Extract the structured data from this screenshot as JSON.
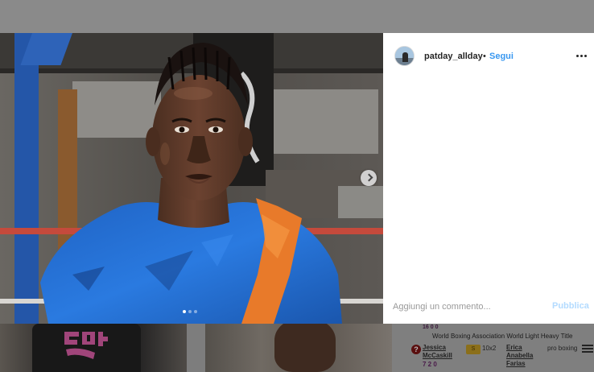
{
  "post": {
    "username": "patday_allday",
    "separator": "•",
    "follow_label": "Segui",
    "more_icon": "more-horizontal-icon",
    "comment_placeholder": "Aggiungi un commento...",
    "publish_label": "Pubblica",
    "carousel": {
      "total": 3,
      "active_index": 0
    },
    "next_icon": "chevron-right-icon",
    "accent_color": "#3897f0"
  },
  "background_page": {
    "score_top": "16 0 0",
    "title": "World Boxing Association World Light Heavy Title",
    "fighter1": "Jessica McCaskill",
    "record1": "7 2 0",
    "badge": "S",
    "rounds": "10x2",
    "fighter2": "Erica Anabella Farias",
    "sport": "pro boxing",
    "question_icon": "question-icon",
    "menu_icon": "hamburger-menu-icon"
  }
}
